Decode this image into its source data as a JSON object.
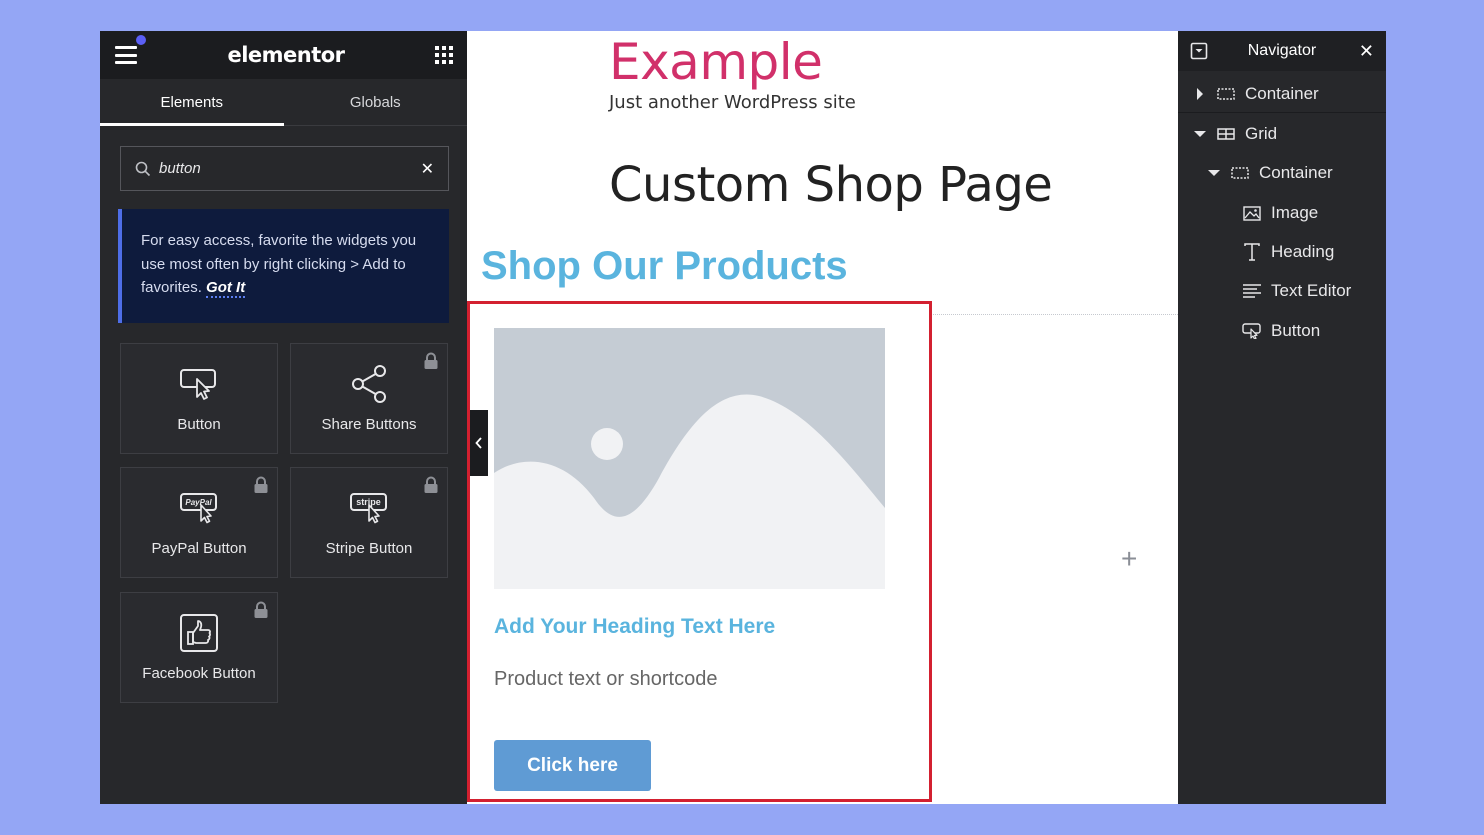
{
  "panel": {
    "logo": "elementor",
    "tabs": [
      {
        "label": "Elements"
      },
      {
        "label": "Globals"
      }
    ],
    "search": {
      "value": "button"
    },
    "tip": {
      "text": "For easy access, favorite the widgets you use most often by right clicking > Add to favorites.",
      "action": "Got It"
    },
    "widgets": [
      {
        "label": "Button",
        "icon": "button-icon",
        "locked": false
      },
      {
        "label": "Share Buttons",
        "icon": "share-icon",
        "locked": true
      },
      {
        "label": "PayPal Button",
        "icon": "paypal-icon",
        "locked": true,
        "icon_text": "PayPal"
      },
      {
        "label": "Stripe Button",
        "icon": "stripe-icon",
        "locked": true,
        "icon_text": "stripe"
      },
      {
        "label": "Facebook Button",
        "icon": "thumbs-up-icon",
        "locked": true
      }
    ]
  },
  "canvas": {
    "site_title": "Example",
    "site_tagline": "Just another WordPress site",
    "page_title": "Custom Shop Page",
    "section_heading": "Shop Our Products",
    "card": {
      "heading": "Add Your Heading Text Here",
      "text": "Product text or shortcode",
      "button": "Click here"
    },
    "add_symbol": "+"
  },
  "navigator": {
    "title": "Navigator",
    "items": [
      {
        "label": "Container",
        "icon": "container-icon",
        "caret": "right",
        "level": 0
      },
      {
        "label": "Grid",
        "icon": "grid-icon",
        "caret": "down",
        "level": 0
      },
      {
        "label": "Container",
        "icon": "container-icon",
        "caret": "down",
        "level": 1
      },
      {
        "label": "Image",
        "icon": "image-icon",
        "caret": "none",
        "level": 2
      },
      {
        "label": "Heading",
        "icon": "heading-icon",
        "caret": "none",
        "level": 2
      },
      {
        "label": "Text Editor",
        "icon": "text-editor-icon",
        "caret": "none",
        "level": 2
      },
      {
        "label": "Button",
        "icon": "button-icon",
        "caret": "none",
        "level": 2
      }
    ]
  },
  "colors": {
    "background": "#94a6f5",
    "panel": "#27282b",
    "site_title": "#d1306a",
    "accent_blue": "#5ab4de",
    "cta": "#5f9bd4",
    "selection_border": "#d32030"
  }
}
